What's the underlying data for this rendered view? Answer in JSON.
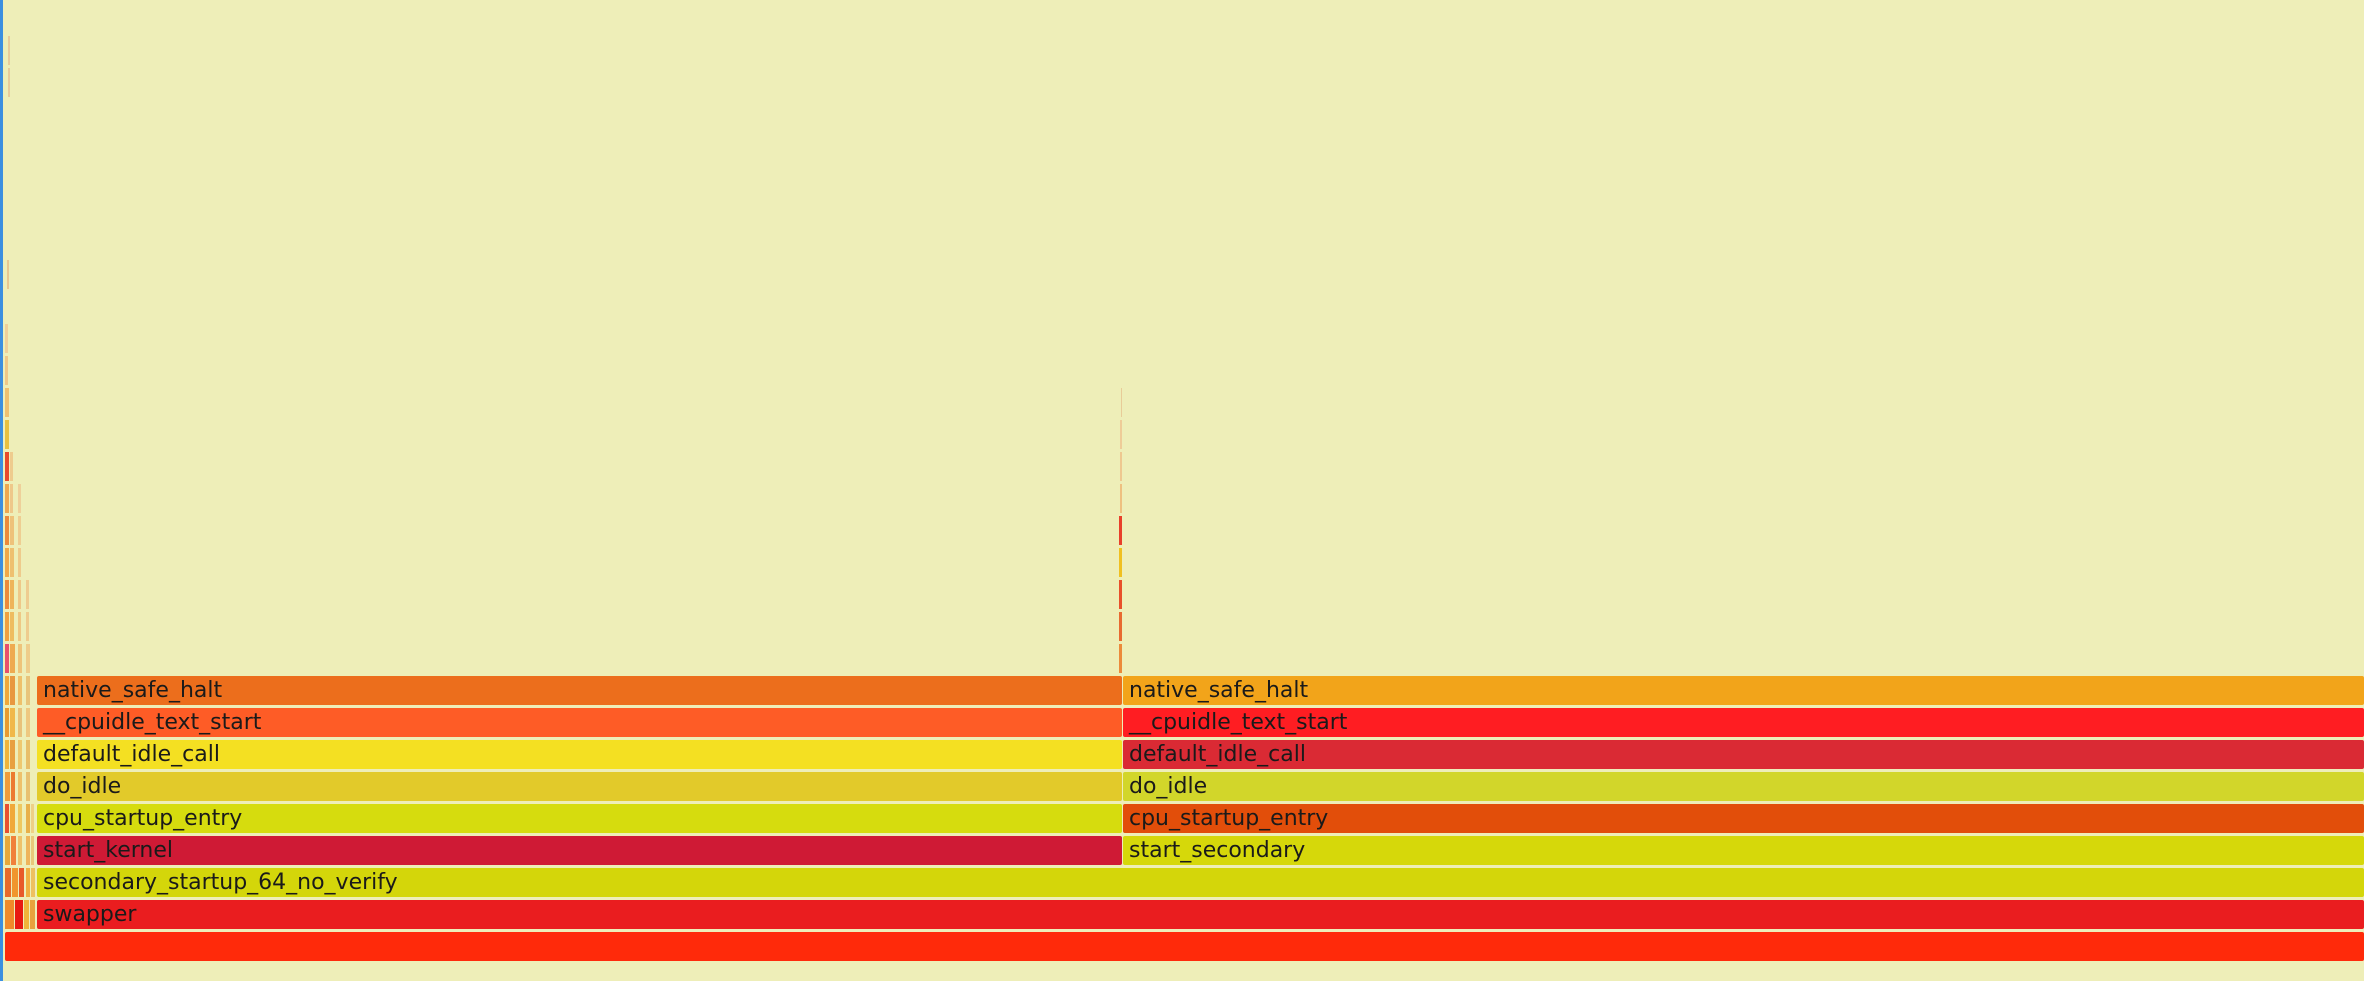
{
  "view": "flame-graph",
  "colors": {
    "background": "#eeeeb8",
    "left_edge": "#3b8fe0"
  },
  "frames": {
    "root": {
      "label": "",
      "color": "#ff2a0a"
    },
    "swapper": {
      "label": "swapper",
      "color": "#ea1d1f"
    },
    "secondary_startup": {
      "label": "secondary_startup_64_no_verify",
      "color": "#d4d60a"
    },
    "left": {
      "start_kernel": {
        "label": "start_kernel",
        "color": "#cf1a35"
      },
      "cpu_startup_entry": {
        "label": "cpu_startup_entry",
        "color": "#d6dc0e"
      },
      "do_idle": {
        "label": "do_idle",
        "color": "#e2ca2a"
      },
      "default_idle_call": {
        "label": "default_idle_call",
        "color": "#f4e022"
      },
      "cpuidle_text_start": {
        "label": "__cpuidle_text_start",
        "color": "#fe5c26"
      },
      "native_safe_halt": {
        "label": "native_safe_halt",
        "color": "#ec6e1c"
      }
    },
    "right": {
      "start_secondary": {
        "label": "start_secondary",
        "color": "#d6d80a"
      },
      "cpu_startup_entry": {
        "label": "cpu_startup_entry",
        "color": "#e24e0a"
      },
      "do_idle": {
        "label": "do_idle",
        "color": "#d2d62a"
      },
      "default_idle_call": {
        "label": "default_idle_call",
        "color": "#da2a34"
      },
      "cpuidle_text_start": {
        "label": "__cpuidle_text_start",
        "color": "#ff1d22"
      },
      "native_safe_halt": {
        "label": "native_safe_halt",
        "color": "#f2a41a"
      }
    }
  }
}
